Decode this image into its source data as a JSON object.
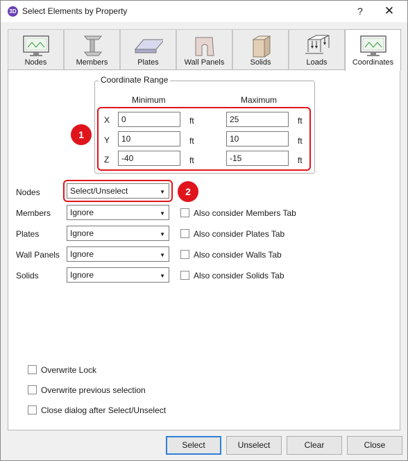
{
  "window": {
    "title": "Select Elements by Property",
    "app_icon": "3D",
    "help": "?",
    "close": "✕"
  },
  "tabs": [
    {
      "label": "Nodes"
    },
    {
      "label": "Members"
    },
    {
      "label": "Plates"
    },
    {
      "label": "Wall Panels"
    },
    {
      "label": "Solids"
    },
    {
      "label": "Loads"
    },
    {
      "label": "Coordinates",
      "active": true
    }
  ],
  "coords": {
    "group_title": "Coordinate Range",
    "min_header": "Minimum",
    "max_header": "Maximum",
    "unit": "ft",
    "rows": [
      {
        "axis": "X",
        "min": "0",
        "max": "25"
      },
      {
        "axis": "Y",
        "min": "10",
        "max": "10"
      },
      {
        "axis": "Z",
        "min": "-40",
        "max": "-15"
      }
    ]
  },
  "annotations": {
    "badge1": "1",
    "badge2": "2",
    "color": "#e0141b"
  },
  "selectors": [
    {
      "label": "Nodes",
      "value": "Select/Unselect"
    },
    {
      "label": "Members",
      "value": "Ignore",
      "check": "Also consider Members Tab"
    },
    {
      "label": "Plates",
      "value": "Ignore",
      "check": "Also consider Plates Tab"
    },
    {
      "label": "Wall Panels",
      "value": "Ignore",
      "check": "Also consider Walls Tab"
    },
    {
      "label": "Solids",
      "value": "Ignore",
      "check": "Also consider Solids Tab"
    }
  ],
  "options": [
    {
      "label": "Overwrite Lock",
      "checked": false
    },
    {
      "label": "Overwrite previous selection",
      "checked": false
    },
    {
      "label": "Close dialog after Select/Unselect",
      "checked": false
    }
  ],
  "buttons": {
    "select": "Select",
    "unselect": "Unselect",
    "clear": "Clear",
    "close": "Close"
  },
  "icons": {
    "nodes": "node-monitor-icon",
    "members": "i-beam-icon",
    "plates": "plate-slab-icon",
    "walls": "wall-panel-icon",
    "solids": "solid-block-icon",
    "loads": "load-frame-icon",
    "coordinates": "coordinate-monitor-icon",
    "dropdown": "chevron-down-icon"
  },
  "colors": {
    "accent": "#2f7fd8",
    "annotation": "#e0141b",
    "app_icon": "#6a3fb5"
  }
}
